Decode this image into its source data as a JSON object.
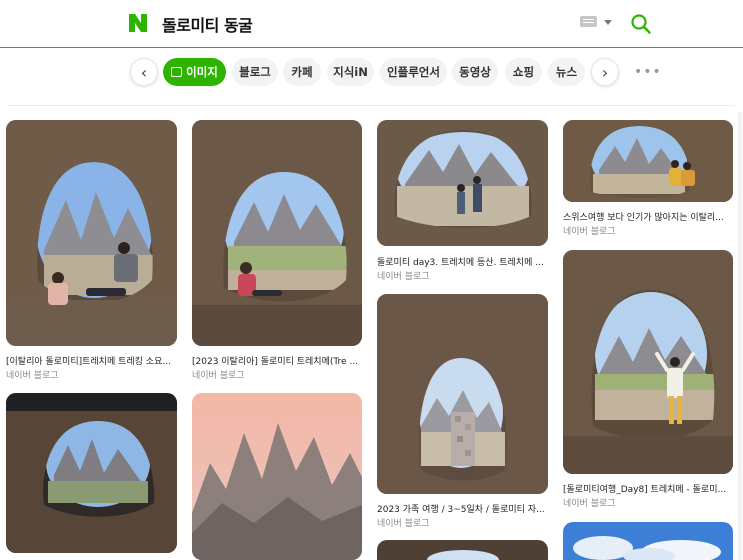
{
  "header": {
    "logo_letter": "N",
    "query": "돌로미티 동굴",
    "brand_color": "#2db400"
  },
  "tabs": [
    {
      "label": "이미지",
      "active": true
    },
    {
      "label": "블로그",
      "active": false
    },
    {
      "label": "카페",
      "active": false
    },
    {
      "label": "지식iN",
      "active": false
    },
    {
      "label": "인플루언서",
      "active": false
    },
    {
      "label": "동영상",
      "active": false
    },
    {
      "label": "쇼핑",
      "active": false
    },
    {
      "label": "뉴스",
      "active": false
    }
  ],
  "icons": {
    "prev": "chevron-left-icon",
    "next": "chevron-right-icon",
    "more": "more-dots-icon",
    "search": "search-icon",
    "keyboard": "keyboard-icon"
  },
  "results": [
    {
      "title": "[이탈리아 돌로미티]트레치메 트레킹 소요...",
      "source": "네이버 블로그"
    },
    {
      "title": "[2023 이탈리아] 돌로미티 트레치메(Tre ...",
      "source": "네이버 블로그"
    },
    {
      "title": "돌로미티 day3. 트레치메 등산. 트레치메 ...",
      "source": "네이버 블로그"
    },
    {
      "title": "스위스여행 보다 인기가 많아지는 이탈리...",
      "source": "네이버 블로그"
    },
    {
      "title": "2023 가족 여행 / 3~5일차 / 돌로미티 자...",
      "source": "네이버 블로그"
    },
    {
      "title": "[돌로미티여행_Day8] 트레치메 - 돌로미...",
      "source": "네이버 블로그"
    }
  ]
}
